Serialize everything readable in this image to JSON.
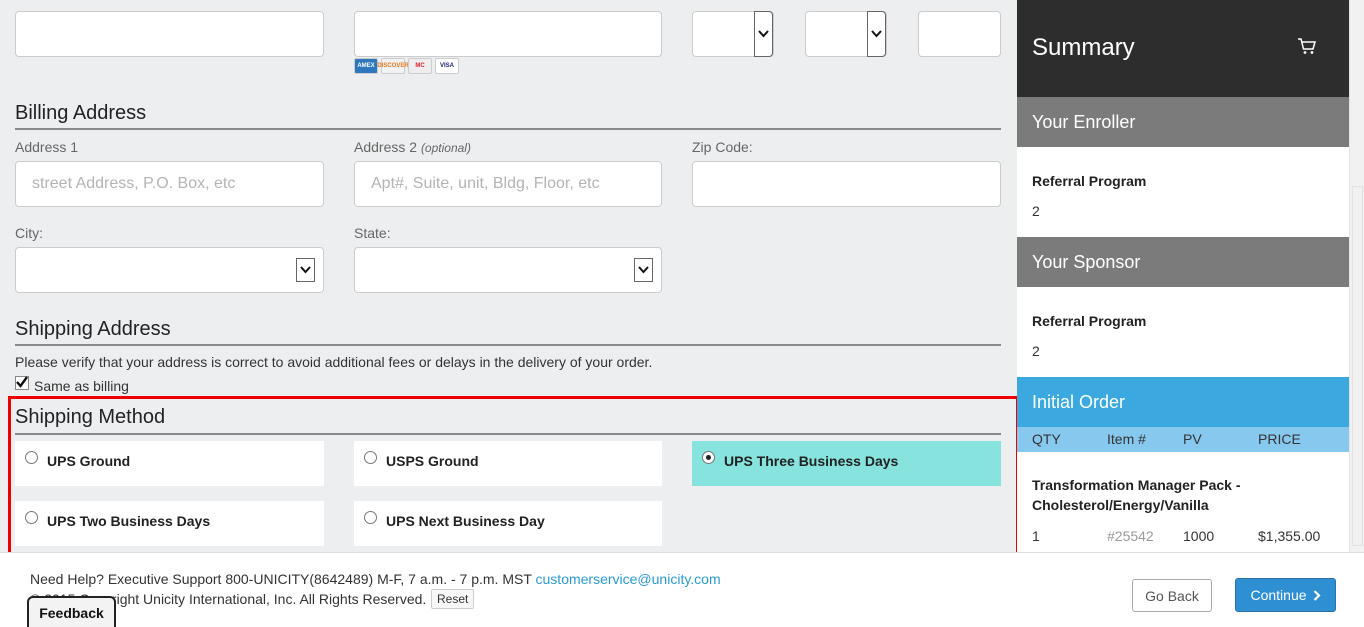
{
  "payment": {
    "card_brands": [
      {
        "name": "AMEX",
        "color": "#2e77bc",
        "text_color": "#ffffff"
      },
      {
        "name": "DISCOVER",
        "color": "#f2f2f2",
        "text_color": "#e8791d"
      },
      {
        "name": "MC",
        "color": "#eeeeee",
        "text_color": "#d8242c"
      },
      {
        "name": "VISA",
        "color": "#ffffff",
        "text_color": "#1a1f71"
      }
    ]
  },
  "billing": {
    "title": "Billing Address",
    "address1_label": "Address 1",
    "address1_placeholder": "street Address, P.O. Box, etc",
    "address2_label": "Address 2",
    "address2_optional": "(optional)",
    "address2_placeholder": "Apt#, Suite, unit, Bldg, Floor, etc",
    "zip_label": "Zip Code:",
    "city_label": "City:",
    "state_label": "State:"
  },
  "shipping_address": {
    "title": "Shipping Address",
    "notice": "Please verify that your address is correct to avoid additional fees or delays in the delivery of your order.",
    "same_as_billing_label": "Same as billing",
    "same_as_billing_checked": true
  },
  "shipping_method": {
    "title": "Shipping Method",
    "options": [
      {
        "label": "UPS Ground",
        "selected": false
      },
      {
        "label": "USPS Ground",
        "selected": false
      },
      {
        "label": "UPS Three Business Days",
        "selected": true
      },
      {
        "label": "UPS Two Business Days",
        "selected": false
      },
      {
        "label": "UPS Next Business Day",
        "selected": false
      }
    ]
  },
  "footer": {
    "help_text": "Need Help? Executive Support 800-UNICITY(8642489) M-F, 7 a.m. - 7 p.m. MST",
    "help_email": "customerservice@unicity.com",
    "copyright": "© 2015 Copyright Unicity International, Inc. All Rights Reserved.",
    "reset_label": "Reset",
    "go_back_label": "Go Back",
    "continue_label": "Continue",
    "feedback_label": "Feedback"
  },
  "summary": {
    "title": "Summary",
    "cart_icon": "cart-icon",
    "enroller": {
      "heading": "Your Enroller",
      "program": "Referral Program",
      "value": "2"
    },
    "sponsor": {
      "heading": "Your Sponsor",
      "program": "Referral Program",
      "value": "2"
    },
    "order": {
      "heading": "Initial Order",
      "columns": {
        "qty": "QTY",
        "item": "Item #",
        "pv": "PV",
        "price": "PRICE"
      },
      "item": {
        "name": "Transformation Manager Pack - Cholesterol/Energy/Vanilla",
        "qty": "1",
        "item_no": "#25542",
        "pv": "1000",
        "price": "$1,355.00"
      }
    }
  },
  "colors": {
    "selected_option": "#86e3dd",
    "highlight_border": "#ee0000",
    "continue_button": "#2e8fd3",
    "order_band": "#3ba9e0"
  }
}
